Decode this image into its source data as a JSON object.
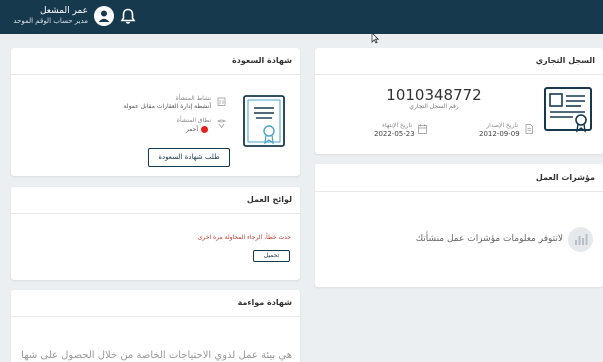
{
  "header": {
    "user_name": "عمر المشعل",
    "user_role": "مدير حساب الوقم الموحد"
  },
  "commercial_register": {
    "title": "السجل التجاري",
    "number": "1010348772",
    "number_label": "رقم السجل التجاري",
    "issue_label": "تاريخ الإصدار",
    "issue_date": "2012-09-09",
    "expiry_label": "تاريخ الإنتهاء",
    "expiry_date": "2022-05-23"
  },
  "saudization": {
    "title": "شهادة السعودة",
    "activity_label": "نشاط المنشأة",
    "activity_value": "أنشطة إدارة العقارات مقابل عمولة",
    "range_label": "نطاق المنشأة",
    "range_value": "أحمر",
    "range_color": "#e3201b",
    "request_button": "طلب شهادة السعودة"
  },
  "indicators": {
    "title": "مؤشرات العمل",
    "empty_message": "لاتتوفر معلومات مؤشرات عمل منشأتك"
  },
  "work_regulations": {
    "title": "لوائح العمل",
    "error_message": "حدث خطأ، الرجاء المحاولة مرة اخرى",
    "reload_button": "تحميل"
  },
  "mowaama": {
    "title": "شهادة مواءمة",
    "text": "هي بيئة عمل لذوي الاحتياجات الخاصة من خلال الحصول على شهادة"
  },
  "colors": {
    "header_bg": "#17394e",
    "page_bg": "#eceff2",
    "accent": "#17394e",
    "error": "#c0392b"
  },
  "icons": [
    "bell-icon",
    "user-avatar-icon",
    "document-icon",
    "certificate-icon",
    "building-icon",
    "range-icon",
    "calendar-icon",
    "chart-icon"
  ]
}
